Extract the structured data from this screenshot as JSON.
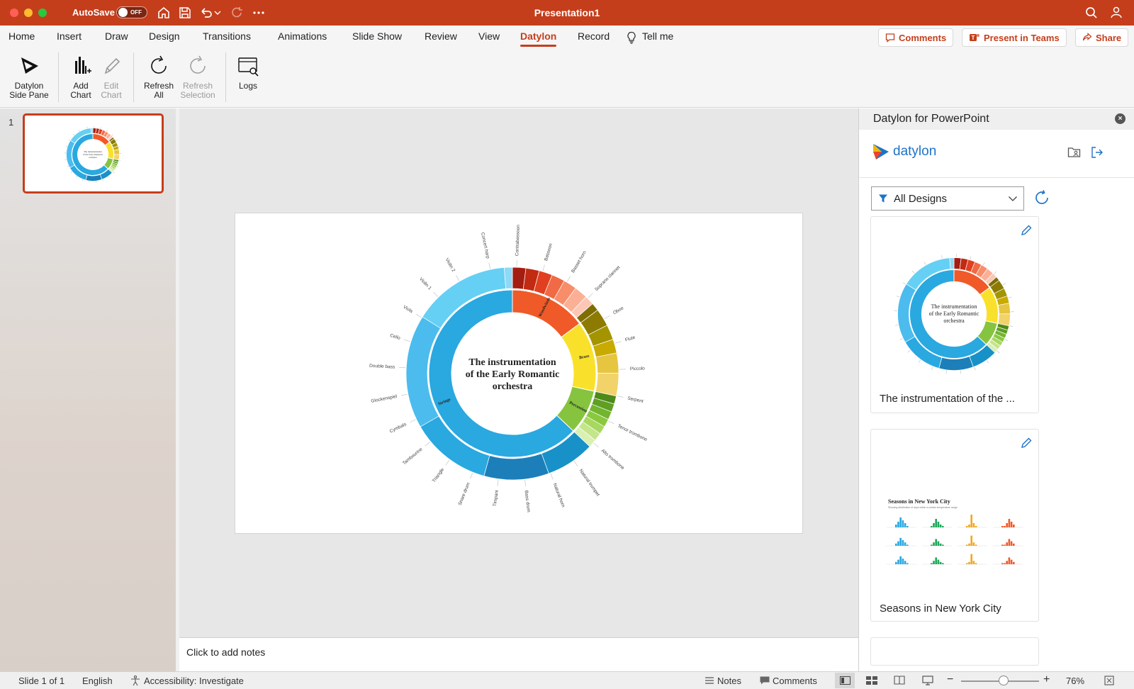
{
  "window": {
    "title": "Presentation1",
    "autosave_label": "AutoSave",
    "autosave_state": "OFF"
  },
  "menu": {
    "items": [
      "Home",
      "Insert",
      "Draw",
      "Design",
      "Transitions",
      "Animations",
      "Slide Show",
      "Review",
      "View",
      "Datylon",
      "Record",
      "Tell me"
    ],
    "active": "Datylon",
    "comments_label": "Comments",
    "present_label": "Present in Teams",
    "share_label": "Share"
  },
  "ribbon": {
    "side_pane": [
      "Datylon",
      "Side Pane"
    ],
    "add_chart": [
      "Add",
      "Chart"
    ],
    "edit_chart": [
      "Edit",
      "Chart"
    ],
    "refresh_all": [
      "Refresh",
      "All"
    ],
    "refresh_selection": [
      "Refresh",
      "Selection"
    ],
    "logs": "Logs"
  },
  "slides": {
    "number": "1"
  },
  "chart": {
    "title_lines": [
      "The instrumentation",
      "of the Early Romantic",
      "orchestra"
    ],
    "inner": [
      {
        "name": "Woodwinds",
        "value": "12",
        "color": "#f05a28"
      },
      {
        "name": "Brass",
        "value": "11",
        "color": "#f9e12b"
      },
      {
        "name": "Percussion",
        "value": "7",
        "color": "#86c43f"
      },
      {
        "name": "Strings",
        "value": "51",
        "color": "#2aa8e0"
      }
    ],
    "outer_labels": [
      "Concert harp",
      "Contrabassoon",
      "Bassoon",
      "Basset horn",
      "Soprano clarinet",
      "Oboe",
      "Flute",
      "Piccolo",
      "Serpent",
      "Tenor trombone",
      "Alto trombone",
      "Natural trumpet",
      "Natural horn",
      "Bass drum",
      "Timpani",
      "Snare drum",
      "Triangle",
      "Tambourine",
      "Cymbals",
      "Glockenspiel",
      "Double bass",
      "Cello",
      "Viola",
      "Violin 1",
      "Violin 2"
    ]
  },
  "notes": {
    "placeholder": "Click to add notes"
  },
  "pane": {
    "title": "Datylon for PowerPoint",
    "brand": "datylon",
    "filter_label": "All Designs",
    "cards": [
      {
        "label": "The instrumentation of the ..."
      },
      {
        "label": "Seasons in New York City",
        "chart_title": "Seasons in New York City",
        "chart_subtitle": "Showing distribution of days within a certain temperature range"
      }
    ]
  },
  "status": {
    "slide": "Slide 1 of 1",
    "language": "English",
    "accessibility": "Accessibility: Investigate",
    "notes": "Notes",
    "comments": "Comments",
    "zoom": "76%"
  }
}
